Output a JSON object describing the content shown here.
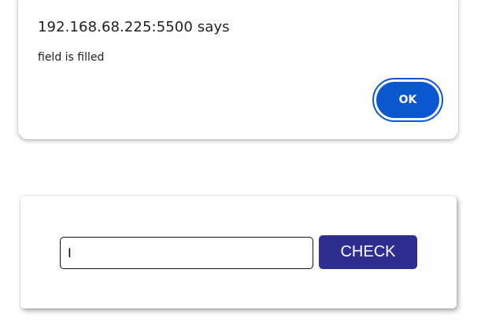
{
  "alert": {
    "title": "192.168.68.225:5500 says",
    "message": "field is filled",
    "ok_label": "OK"
  },
  "form": {
    "input_value": "I",
    "check_label": "CHECK"
  },
  "colors": {
    "ok_button": "#0b57d0",
    "check_button": "#2e2e91"
  }
}
